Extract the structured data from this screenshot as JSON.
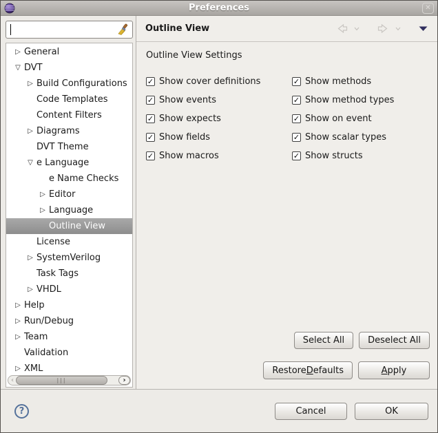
{
  "window": {
    "title": "Preferences",
    "close_glyph": "✕"
  },
  "sidebar": {
    "filter_placeholder": "",
    "tree": [
      {
        "label": "General",
        "level": 0,
        "state": "collapsed",
        "selected": false
      },
      {
        "label": "DVT",
        "level": 0,
        "state": "expanded",
        "selected": false
      },
      {
        "label": "Build Configurations",
        "level": 1,
        "state": "collapsed",
        "selected": false
      },
      {
        "label": "Code Templates",
        "level": 1,
        "state": "leaf",
        "selected": false
      },
      {
        "label": "Content Filters",
        "level": 1,
        "state": "leaf",
        "selected": false
      },
      {
        "label": "Diagrams",
        "level": 1,
        "state": "collapsed",
        "selected": false
      },
      {
        "label": "DVT Theme",
        "level": 1,
        "state": "leaf",
        "selected": false
      },
      {
        "label": "e Language",
        "level": 1,
        "state": "expanded",
        "selected": false
      },
      {
        "label": "e Name Checks",
        "level": 2,
        "state": "leaf",
        "selected": false
      },
      {
        "label": "Editor",
        "level": 2,
        "state": "collapsed",
        "selected": false
      },
      {
        "label": "Language",
        "level": 2,
        "state": "collapsed",
        "selected": false
      },
      {
        "label": "Outline View",
        "level": 2,
        "state": "leaf",
        "selected": true
      },
      {
        "label": "License",
        "level": 1,
        "state": "leaf",
        "selected": false
      },
      {
        "label": "SystemVerilog",
        "level": 1,
        "state": "collapsed",
        "selected": false
      },
      {
        "label": "Task Tags",
        "level": 1,
        "state": "leaf",
        "selected": false
      },
      {
        "label": "VHDL",
        "level": 1,
        "state": "collapsed",
        "selected": false
      },
      {
        "label": "Help",
        "level": 0,
        "state": "collapsed",
        "selected": false
      },
      {
        "label": "Run/Debug",
        "level": 0,
        "state": "collapsed",
        "selected": false
      },
      {
        "label": "Team",
        "level": 0,
        "state": "collapsed",
        "selected": false
      },
      {
        "label": "Validation",
        "level": 0,
        "state": "leaf",
        "selected": false
      },
      {
        "label": "XML",
        "level": 0,
        "state": "collapsed",
        "selected": false
      }
    ],
    "glyphs": {
      "collapsed": "▷",
      "expanded": "▽",
      "scroll_left": "‹",
      "scroll_right": "›",
      "scroll_grip": "|||"
    }
  },
  "page": {
    "title": "Outline View",
    "settings_label": "Outline View Settings",
    "checkbox_columns": [
      [
        {
          "label": "Show cover definitions",
          "checked": true
        },
        {
          "label": "Show events",
          "checked": true
        },
        {
          "label": "Show expects",
          "checked": true
        },
        {
          "label": "Show fields",
          "checked": true
        },
        {
          "label": "Show macros",
          "checked": true
        }
      ],
      [
        {
          "label": "Show methods",
          "checked": true
        },
        {
          "label": "Show method types",
          "checked": true
        },
        {
          "label": "Show on event",
          "checked": true
        },
        {
          "label": "Show scalar types",
          "checked": true
        },
        {
          "label": "Show structs",
          "checked": true
        }
      ]
    ],
    "check_glyph": "✓",
    "buttons": {
      "select_all": {
        "label": "Select All"
      },
      "deselect_all": {
        "label": "Deselect All"
      },
      "restore_defaults": {
        "label": "Restore Defaults",
        "mnemonic": "D"
      },
      "apply": {
        "label": "Apply",
        "mnemonic": "A"
      }
    }
  },
  "footer": {
    "help_glyph": "?",
    "cancel_label": "Cancel",
    "ok_label": "OK"
  }
}
